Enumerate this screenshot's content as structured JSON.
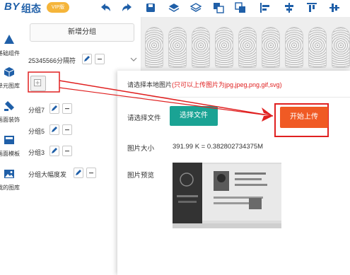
{
  "app": {
    "logo_latin": "BY",
    "logo_cn": "组态",
    "vip_badge": "VIP版"
  },
  "toolbar": {
    "icons": [
      "undo-icon",
      "redo-icon",
      "save-icon",
      "layer-up-icon",
      "layer-down-icon",
      "bring-front-icon",
      "send-back-icon",
      "align-left-icon",
      "align-center-icon",
      "align-top-icon",
      "align-middle-icon"
    ]
  },
  "sidebar": {
    "items": [
      {
        "label": "基础组件",
        "icon": "basic-component-icon"
      },
      {
        "label": "单元图库",
        "icon": "cube-icon"
      },
      {
        "label": "画面装饰",
        "icon": "decoration-icon"
      },
      {
        "label": "画面模板",
        "icon": "template-icon"
      },
      {
        "label": "我的图库",
        "icon": "image-icon"
      }
    ]
  },
  "groups": {
    "add_label": "新增分组",
    "list": [
      {
        "name": "25345566分隔符",
        "expanded": true
      },
      {
        "name": "分组7"
      },
      {
        "name": "分组5"
      },
      {
        "name": "分组3"
      },
      {
        "name": "分组大幅度发"
      }
    ]
  },
  "dialog": {
    "title_prefix": "请选择本地图片",
    "title_warning": "(只可以上传图片为jpg,jpeg,png,gif,svg)",
    "choose_label": "请选择文件",
    "choose_button": "选择文件",
    "upload_button": "开始上传",
    "size_label": "图片大小",
    "size_value": "391.99 K = 0.382802734375M",
    "preview_label": "图片预览"
  },
  "colors": {
    "brand": "#1f5fa8",
    "choose_button": "#1aa394",
    "upload_button": "#f05a24",
    "annotation": "#e02020",
    "vip": "#f5b53a"
  }
}
